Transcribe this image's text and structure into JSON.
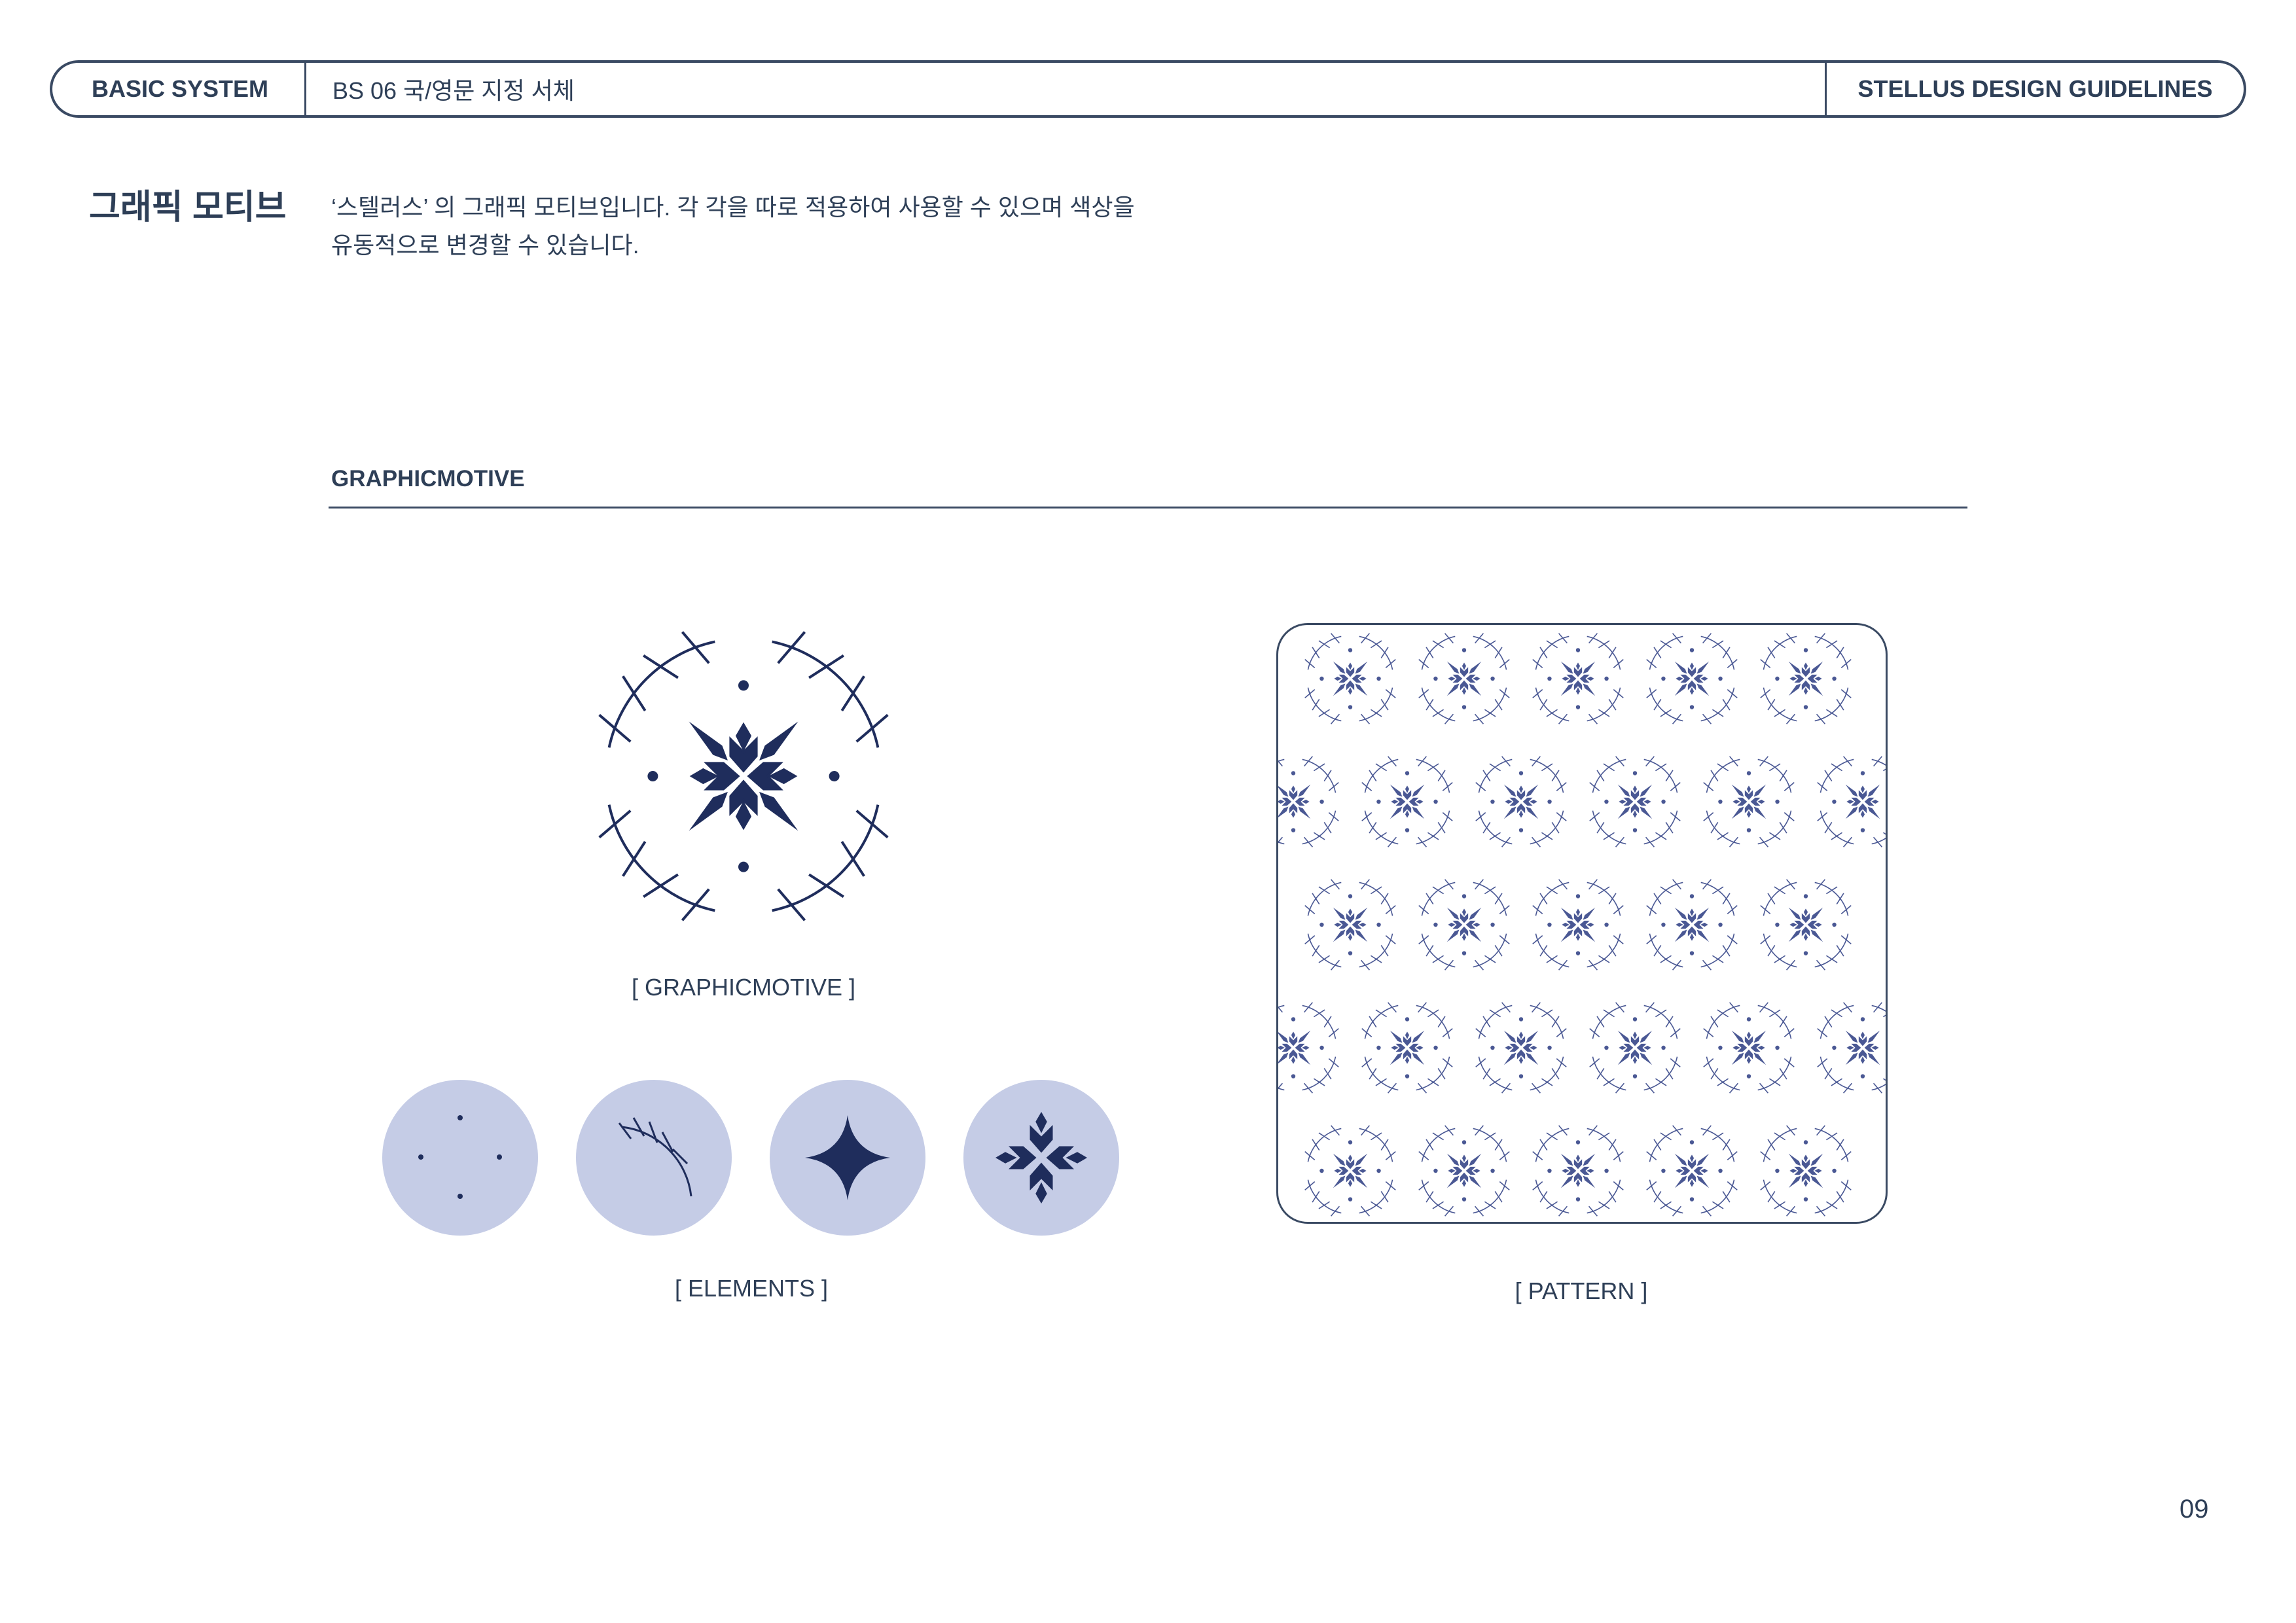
{
  "header": {
    "left_label": "BASIC SYSTEM",
    "middle_label": "BS 06  국/영문 지정 서체",
    "right_label": "STELLUS DESIGN GUIDELINES"
  },
  "section": {
    "title": "그래픽 모티브",
    "description": "‘스텔러스’ 의 그래픽 모티브입니다. 각 각을 따로 적용하여 사용할 수 있으며 색상을\n유동적으로 변경할 수 있습니다."
  },
  "subsection": {
    "heading": "GRAPHICMOTIVE"
  },
  "captions": {
    "motive": "[ GRAPHICMOTIVE ]",
    "elements": "[ ELEMENTS ]",
    "pattern": "[ PATTERN ]"
  },
  "elements": [
    {
      "icon": "dots-icon"
    },
    {
      "icon": "arc-ticks-icon"
    },
    {
      "icon": "four-point-star-icon"
    },
    {
      "icon": "snowflake-icon"
    }
  ],
  "colors": {
    "primary_navy": "#1f2d5c",
    "text": "#2e3f57",
    "element_circle": "#c5cce6",
    "pattern_line": "#4a5894"
  },
  "page_number": "09"
}
